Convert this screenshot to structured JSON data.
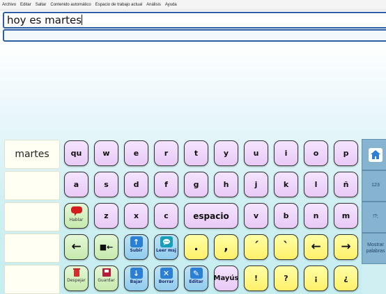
{
  "menu": [
    "Archivo",
    "Editar",
    "Saltar",
    "Contenido automático",
    "Espacio de trabajo actual",
    "Análisis",
    "Ayuda"
  ],
  "text_area": {
    "value": "hoy es martes"
  },
  "predictions": [
    "martes",
    "",
    "",
    "",
    ""
  ],
  "row1": [
    "qu",
    "w",
    "e",
    "r",
    "t",
    "y",
    "u",
    "i",
    "o",
    "p"
  ],
  "row2": [
    "a",
    "s",
    "d",
    "f",
    "g",
    "h",
    "j",
    "k",
    "l",
    "ñ"
  ],
  "row3": [
    "z",
    "x",
    "c",
    "v",
    "b",
    "n",
    "m"
  ],
  "space_label": "espacio",
  "hablar_label": "Hablar",
  "row4": {
    "backspace": "←",
    "delete_word": "■←",
    "subir": "Subir",
    "leer": "Leer msj",
    "period": ".",
    "comma": ",",
    "acute": "´",
    "grave": "`",
    "left": "←",
    "right": "→"
  },
  "row5": {
    "despejar": "Despejar",
    "guardar": "Guardar",
    "bajar": "Bajar",
    "borrar": "Borrar",
    "editar": "Editar",
    "mayus": "Mayús",
    "excl": "!",
    "quest": "?",
    "inv_excl": "¡",
    "inv_quest": "¿"
  },
  "side": {
    "num": "123",
    "punct": "!?;",
    "mostrar": "Mostrar palabras"
  },
  "colors": {
    "accent": "#2d5fa6",
    "key_pink": "#e9c9f6",
    "key_yellow": "#ffef6a",
    "key_green": "#c6e9ad",
    "key_blue": "#8fcbed",
    "side_panel": "#86b3d0"
  },
  "icons": [
    "home-icon",
    "speech-icon",
    "up-arrow-icon",
    "speech-bubble-icon",
    "down-arrow-icon",
    "close-icon",
    "pencil-icon",
    "trash-icon",
    "save-icon"
  ]
}
